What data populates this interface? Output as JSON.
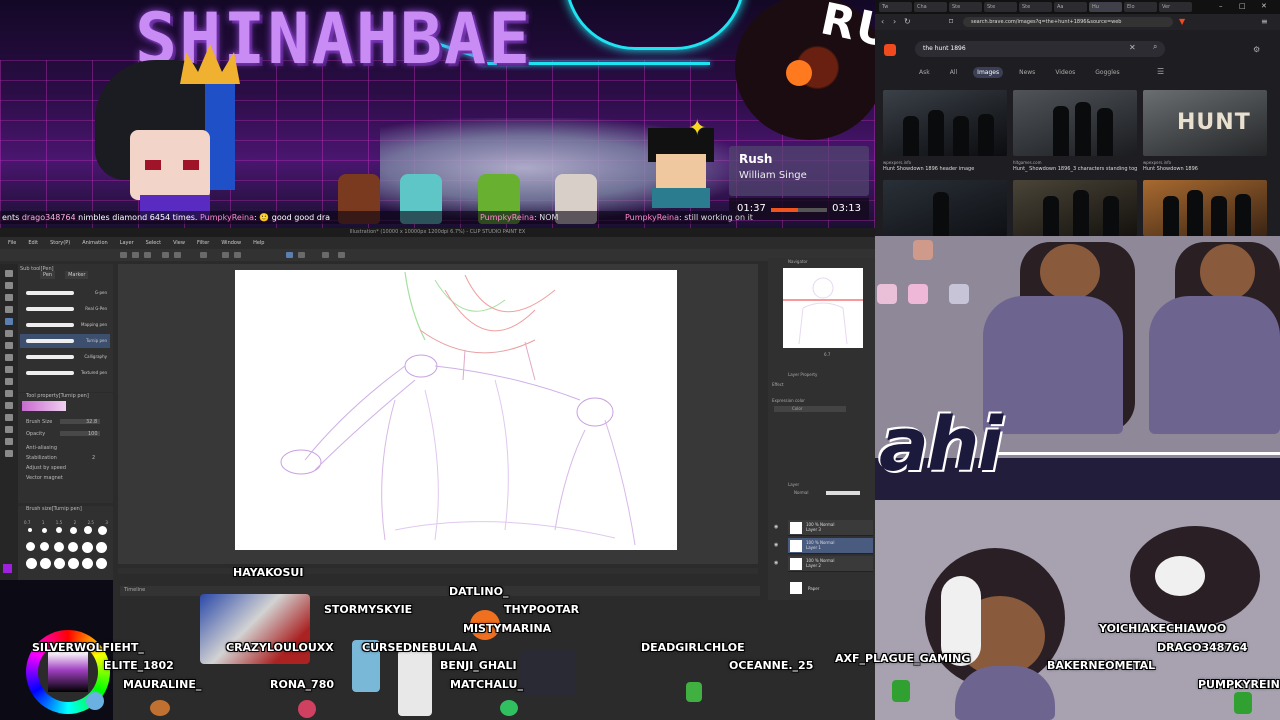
{
  "stream": {
    "channel_title": "SHINAHBAE",
    "now_playing": {
      "title": "Rush",
      "artist": "William Singe",
      "current": "01:37",
      "duration": "03:13",
      "progress": 0.49
    },
    "record_text": "RUSH",
    "chat": [
      {
        "user": "drago348764",
        "text": " nimbles diamond 6454 times. "
      },
      {
        "user": "PumpkyReina",
        "text": ": 🙂 good good "
      },
      {
        "user": "PumpkyReina",
        "text": ": NOM "
      },
      {
        "user": "PumpkyReina",
        "text": ": still working on it"
      }
    ],
    "chat_prefix": "ents ",
    "chat_mid": " dra"
  },
  "browser": {
    "tabs": [
      "Tw",
      "Cha",
      "Ste",
      "Ste",
      "Ste",
      "Aa",
      "Hu",
      "Elo",
      "Ver"
    ],
    "url": "search.brave.com/images?q=the+hunt+1896&source=web",
    "search_query": "the hunt 1896",
    "result_tabs": [
      "Ask",
      "All",
      "Images",
      "News",
      "Videos",
      "Goggles"
    ],
    "active_tab": "Images",
    "results": [
      {
        "source": "wpexpers.info",
        "title": "Hunt Showdown 1896 header image"
      },
      {
        "source": "hltgames.com",
        "title": "Hunt_ Showdown 1896_3 characters standing tog"
      },
      {
        "source": "wpexpers.info",
        "title": "Hunt Showdown 1896"
      }
    ],
    "hunt_logo": "HUNT",
    "colors": {
      "accent": "#f04a1e",
      "bg": "#1e1e22"
    }
  },
  "csp": {
    "title": "Illustration* (10000 x 10000px 1200dpi 6.7%) - CLIP STUDIO PAINT EX",
    "menu": [
      "File",
      "Edit",
      "Story(P)",
      "Animation",
      "Layer",
      "Select",
      "View",
      "Filter",
      "Window",
      "Help"
    ],
    "subtool_header": "Sub tool[Pen]",
    "subtool_tabs": [
      "Pen",
      "Marker"
    ],
    "brushes": [
      "G-pen",
      "Real G-Pen",
      "Mapping pen",
      "Turnip pen",
      "Calligraphy",
      "Textured pen"
    ],
    "selected_brush": "Turnip pen",
    "tool_property_header": "Tool property[Turnip pen]",
    "props": [
      {
        "label": "Brush Size",
        "value": "32.8"
      },
      {
        "label": "Opacity",
        "value": "100"
      },
      {
        "label": "Anti-aliasing",
        "value": ""
      },
      {
        "label": "Stabilization",
        "value": "2"
      },
      {
        "label": "Adjust by speed",
        "value": ""
      },
      {
        "label": "Vector magnet",
        "value": ""
      }
    ],
    "brush_size_header": "Brush size[Turnip pen]",
    "brush_sizes": [
      "0.7",
      "1",
      "1.5",
      "2",
      "2.5",
      "3"
    ],
    "navigator_label": "Navigator",
    "zoom": "6.7",
    "layer_property_label": "Layer Property",
    "effect_label": "Effect",
    "expression_color_label": "Expression color",
    "color_label": "Color",
    "layers_label": "Layer",
    "blend_mode": "Normal",
    "layers": [
      {
        "opacity": "100 % Normal",
        "name": "Layer 3"
      },
      {
        "opacity": "100 % Normal",
        "name": "Layer 1"
      },
      {
        "opacity": "100 % Normal",
        "name": "Layer 2"
      },
      {
        "opacity": "",
        "name": "Paper"
      }
    ],
    "selected_layer": 1,
    "timeline_label": "Timeline"
  },
  "art": {
    "big_word": "ahi"
  },
  "viewers": [
    {
      "name": "HAYAKOSUI"
    },
    {
      "name": "DATLINO_"
    },
    {
      "name": "STORMYSKYIE"
    },
    {
      "name": "THYPOOTAR"
    },
    {
      "name": "MISTYMARINA"
    },
    {
      "name": "SILVERWOLFIEHT_"
    },
    {
      "name": "CRAZYLOULOUXX"
    },
    {
      "name": "CURSEDNEBULALA"
    },
    {
      "name": "DEADGIRLCHLOE"
    },
    {
      "name": "YOICHIAKECHIAWOO"
    },
    {
      "name": "ELITE_1802"
    },
    {
      "name": "BENJI_GHALI"
    },
    {
      "name": "OCEANNE._25"
    },
    {
      "name": "DRAGO348764"
    },
    {
      "name": "MAURALINE_"
    },
    {
      "name": "RONA_780"
    },
    {
      "name": "MATCHALU_"
    },
    {
      "name": "AXF_PLAGUE_GAMING"
    },
    {
      "name": "BAKERNEOMETAL"
    },
    {
      "name": "PUMPKYREIN"
    }
  ]
}
